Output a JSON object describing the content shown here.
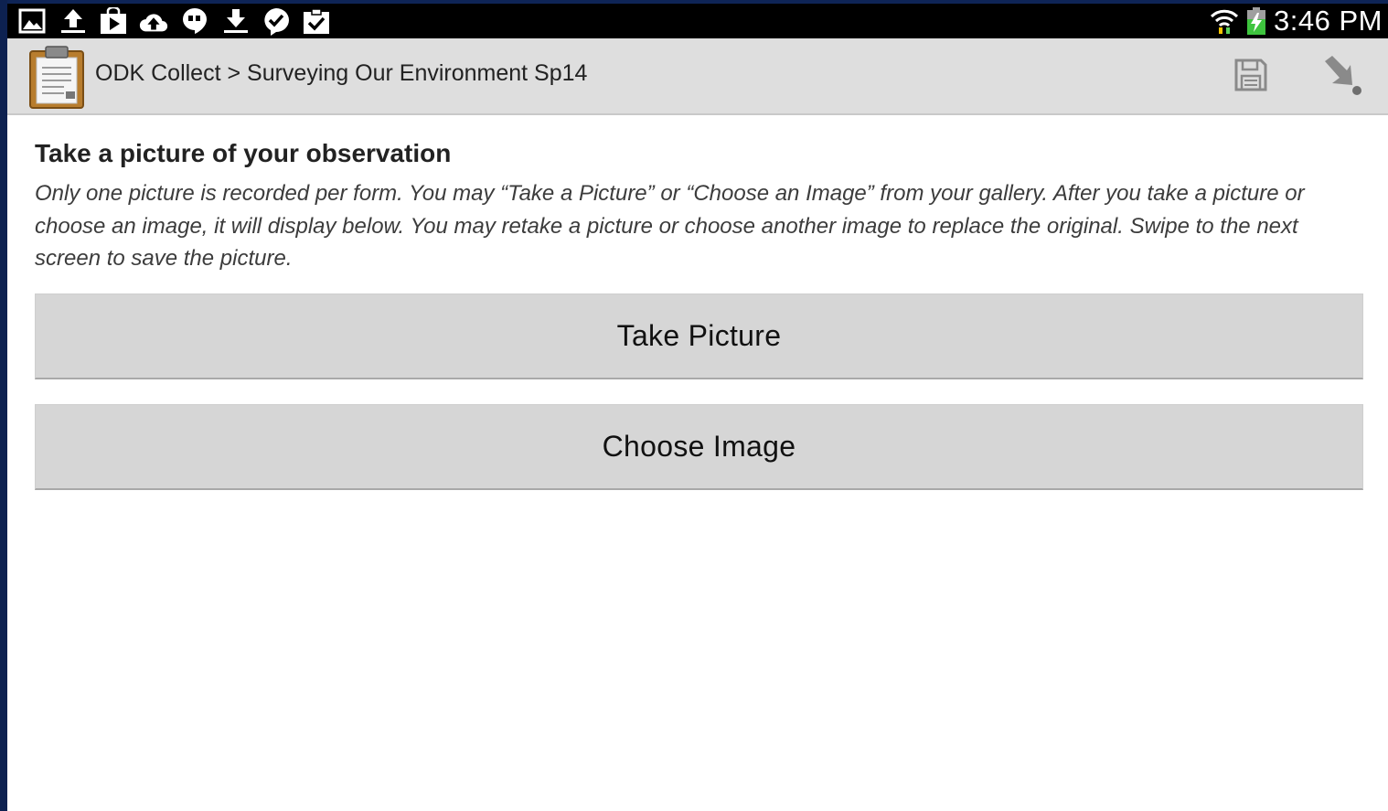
{
  "status_bar": {
    "notification_icons": [
      "gallery-icon",
      "upload-icon",
      "play-store-icon",
      "cloud-upload-icon",
      "hangouts-icon",
      "download-icon",
      "messenger-icon",
      "clipboard-check-icon"
    ],
    "time": "3:46 PM",
    "system_icons": [
      "wifi-icon",
      "battery-charging-icon"
    ]
  },
  "action_bar": {
    "app_icon": "clipboard-icon",
    "title": "ODK Collect > Surveying Our Environment Sp14",
    "actions": [
      "save-icon",
      "go-to-prompt-icon"
    ]
  },
  "form": {
    "question": "Take a picture of your observation",
    "hint": "Only one picture is recorded per form. You may “Take a Picture” or “Choose an Image” from your gallery. After you take a picture or choose an image, it will display below. You may retake a picture or choose another image to replace the original. Swipe to the next screen to save the picture.",
    "take_picture_label": "Take Picture",
    "choose_image_label": "Choose Image"
  },
  "colors": {
    "status_bar_bg": "#000000",
    "action_bar_bg": "#dedede",
    "button_bg": "#d6d6d6",
    "frame": "#0e2456"
  }
}
